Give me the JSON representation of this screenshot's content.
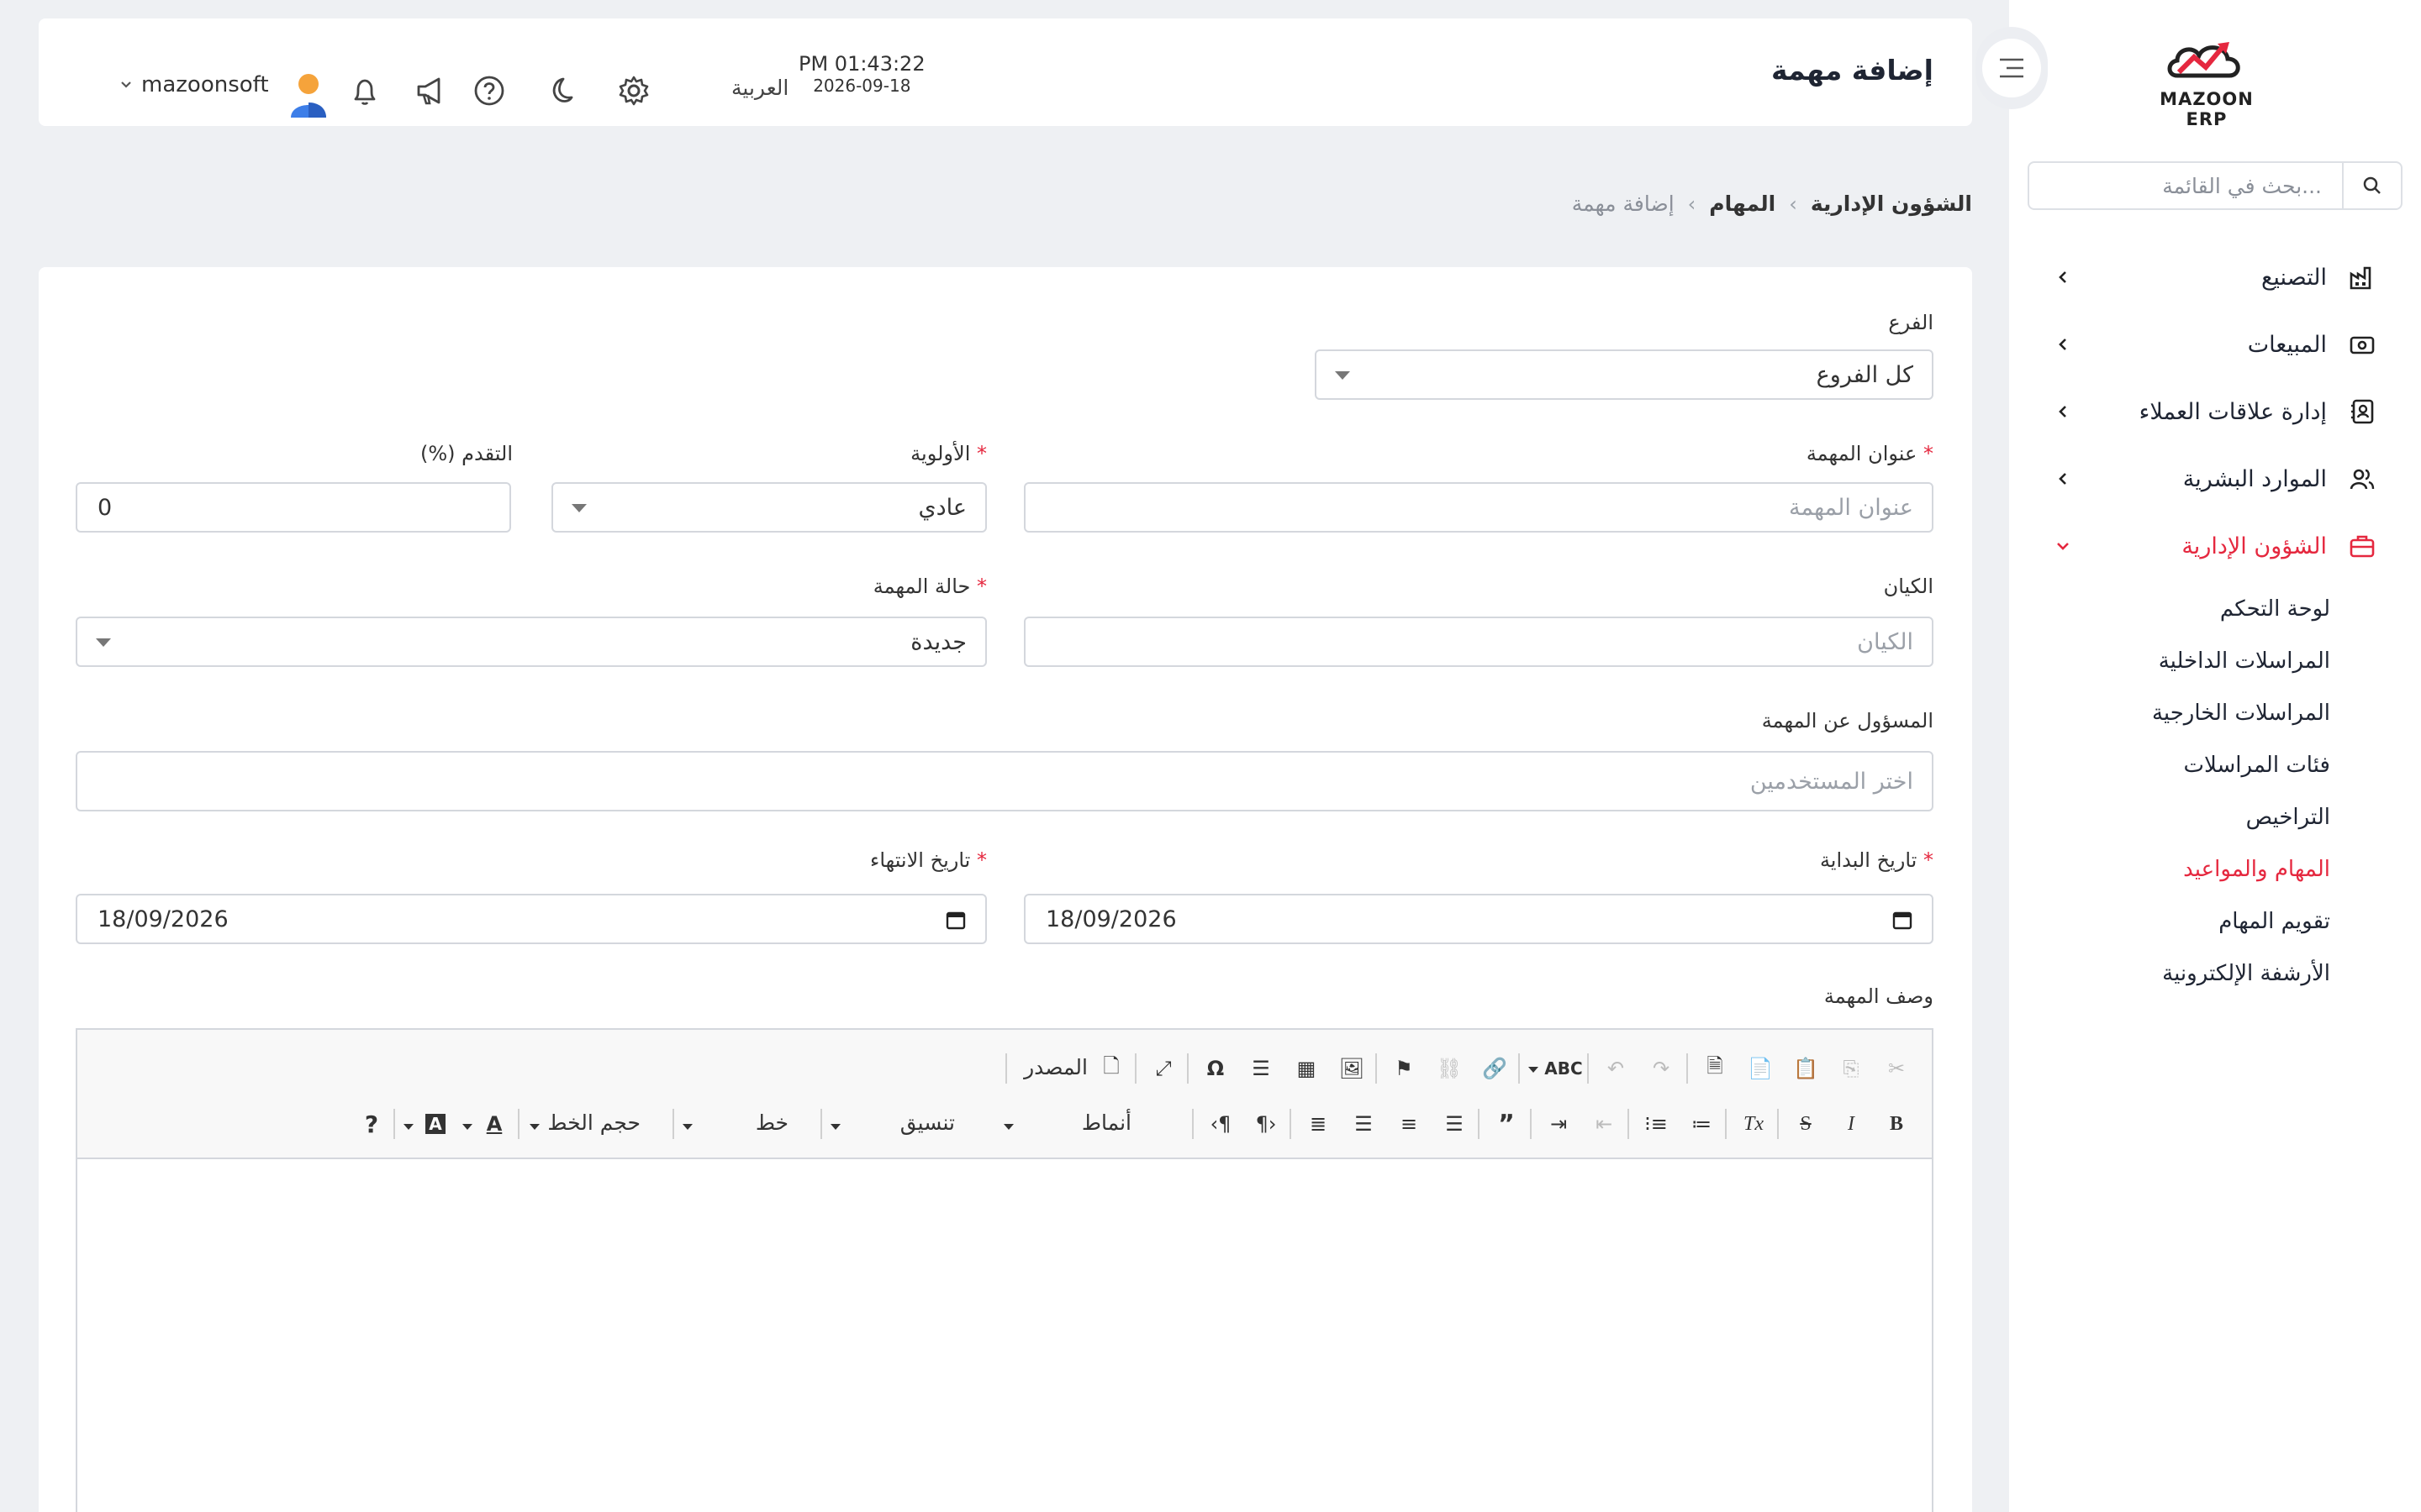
{
  "sidebar": {
    "logo_text": "MAZOON ERP",
    "search_placeholder": "بحث في القائمة...",
    "items": [
      {
        "label": "التصنيع"
      },
      {
        "label": "المبيعات"
      },
      {
        "label": "إدارة علاقات العملاء"
      },
      {
        "label": "الموارد البشرية"
      },
      {
        "label": "الشؤون الإدارية"
      }
    ],
    "subitems": [
      {
        "label": "لوحة التحكم"
      },
      {
        "label": "المراسلات الداخلية"
      },
      {
        "label": "المراسلات الخارجية"
      },
      {
        "label": "فئات المراسلات"
      },
      {
        "label": "التراخيص"
      },
      {
        "label": "المهام والمواعيد"
      },
      {
        "label": "تقويم المهام"
      },
      {
        "label": "الأرشفة الإلكترونية"
      }
    ],
    "active_color": "#e5283f"
  },
  "header": {
    "title": "إضافة مهمة",
    "time": "PM 01:43:22",
    "date": "2026-09-18",
    "language": "العربية",
    "username": "mazoonsoft"
  },
  "breadcrumb": {
    "level1": "الشؤون الإدارية",
    "level2": "المهام",
    "current": "إضافة مهمة"
  },
  "form": {
    "branch_label": "الفرع",
    "branch_value": "كل الفروع",
    "task_title_label": "عنوان المهمة",
    "task_title_placeholder": "عنوان المهمة",
    "priority_label": "الأولوية",
    "priority_value": "عادي",
    "progress_label": "التقدم (%)",
    "progress_value": "0",
    "entity_label": "الكيان",
    "entity_placeholder": "الكيان",
    "status_label": "حالة المهمة",
    "status_value": "جديدة",
    "assignee_label": "المسؤول عن المهمة",
    "assignee_placeholder": "اختر المستخدمين",
    "start_date_label": "تاريخ البداية",
    "start_date_value": "18/09/2026",
    "end_date_label": "تاريخ الانتهاء",
    "end_date_value": "18/09/2026",
    "description_label": "وصف المهمة",
    "required_mark": "*"
  },
  "editor": {
    "source_label": "المصدر",
    "styles_label": "أنماط",
    "format_label": "تنسيق",
    "font_label": "خط",
    "size_label": "حجم الخط",
    "help_label": "?"
  }
}
